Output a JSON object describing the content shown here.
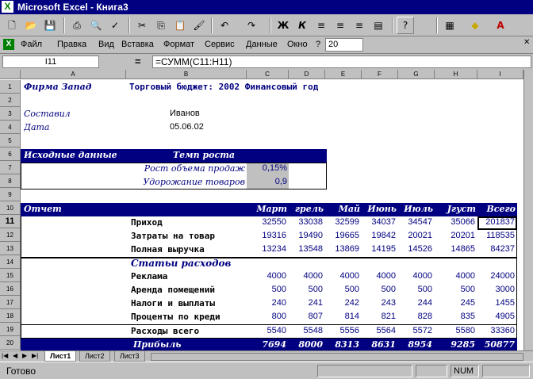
{
  "window": {
    "title": "Microsoft Excel - Книга3"
  },
  "menu": [
    "Файл",
    "Правка",
    "Вид",
    "Вставка",
    "Формат",
    "Сервис",
    "Данные",
    "Окно",
    "?"
  ],
  "font_size": "20",
  "formula": {
    "name": "I11",
    "eq": "=",
    "content": "=СУММ(C11:H11)"
  },
  "columns": [
    "A",
    "B",
    "C",
    "D",
    "E",
    "F",
    "G",
    "H",
    "I"
  ],
  "rows": [
    "1",
    "2",
    "3",
    "4",
    "5",
    "6",
    "7",
    "8",
    "9",
    "10",
    "11",
    "12",
    "13",
    "14",
    "15",
    "16",
    "17",
    "18",
    "19",
    "20"
  ],
  "sheet": {
    "company": "Фирма Запад",
    "budget_title": "Торговый бюджет: 2002 Финансовый год",
    "compiled_label": "Составил",
    "compiled_value": "Иванов",
    "date_label": "Дата",
    "date_value": "05.06.02",
    "input_header": "Исходные данные",
    "growth_header": "Темп роста",
    "sales_growth_label": "Рост объема продаж",
    "sales_growth_value": "0,15%",
    "cost_growth_label": "Удорожание товаров",
    "cost_growth_value": "0,9",
    "report_label": "Отчет",
    "months": [
      "Март",
      "Апрель",
      "Май",
      "Июнь",
      "Июль",
      "Август",
      "Всего"
    ],
    "months_display": [
      "Март",
      "грель",
      "Май",
      "Июнь",
      "Июль",
      "Јгуст",
      "Всего"
    ],
    "income": {
      "label": "Приход",
      "values": [
        "32550",
        "33038",
        "32599",
        "34037",
        "34547",
        "35066",
        "201837"
      ]
    },
    "costs": {
      "label": "Затраты на товар",
      "values": [
        "19316",
        "19490",
        "19665",
        "19842",
        "20021",
        "20201",
        "118535"
      ]
    },
    "gross": {
      "label": "Полная выручка",
      "values": [
        "13234",
        "13548",
        "13869",
        "14195",
        "14526",
        "14865",
        "84237"
      ]
    },
    "expenses_header": "Статьи расходов",
    "ads": {
      "label": "Реклама",
      "values": [
        "4000",
        "4000",
        "4000",
        "4000",
        "4000",
        "4000",
        "24000"
      ]
    },
    "rent": {
      "label": "Аренда помещений",
      "values": [
        "500",
        "500",
        "500",
        "500",
        "500",
        "500",
        "3000"
      ]
    },
    "taxes": {
      "label": "Налоги и выплаты",
      "values": [
        "240",
        "241",
        "242",
        "243",
        "244",
        "245",
        "1455"
      ]
    },
    "interest": {
      "label": "Проценты по креди",
      "values": [
        "800",
        "807",
        "814",
        "821",
        "828",
        "835",
        "4905"
      ]
    },
    "total_exp": {
      "label": "Расходы всего",
      "values": [
        "5540",
        "5548",
        "5556",
        "5564",
        "5572",
        "5580",
        "33360"
      ]
    },
    "profit": {
      "label": "Прибыль",
      "values": [
        "7694",
        "8000",
        "8313",
        "8631",
        "8954",
        "9285",
        "50877"
      ]
    }
  },
  "tabs": [
    "Лист1",
    "Лист2",
    "Лист3"
  ],
  "status": {
    "ready": "Готово",
    "num": "NUM"
  },
  "colors": {
    "navy": "#000080",
    "gray": "#c0c0c0",
    "selected": "#c0c0c0"
  }
}
